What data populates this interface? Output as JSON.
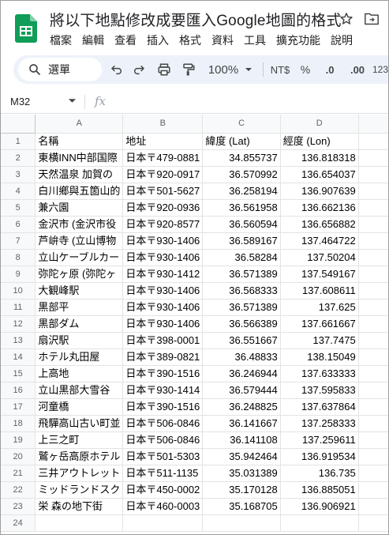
{
  "app": {
    "title": "將以下地點修改成要匯入Google地圖的格式",
    "menu": [
      "檔案",
      "編輯",
      "查看",
      "插入",
      "格式",
      "資料",
      "工具",
      "擴充功能",
      "說明"
    ]
  },
  "toolbar": {
    "menu_search_label": "選單",
    "zoom": "100%",
    "currency": "NT$",
    "percent": "%",
    "dec_decrease": ".0",
    "dec_increase": ".00",
    "more_formats": "123"
  },
  "formula_bar": {
    "cell_ref": "M32",
    "fx": "fx",
    "content": ""
  },
  "grid": {
    "columns": [
      "A",
      "B",
      "C",
      "D"
    ],
    "row_numbers": [
      "1",
      "2",
      "3",
      "4",
      "5",
      "6",
      "7",
      "8",
      "9",
      "10",
      "11",
      "12",
      "13",
      "14",
      "15",
      "16",
      "17",
      "18",
      "19",
      "20",
      "21",
      "22",
      "23",
      "24"
    ],
    "header": [
      "名稱",
      "地址",
      "緯度 (Lat)",
      "經度 (Lon)"
    ],
    "rows": [
      [
        "東横INN中部国際",
        "日本〒479-0881",
        "34.855737",
        "136.818318"
      ],
      [
        "天然温泉 加賀の",
        "日本〒920-0917",
        "36.570992",
        "136.654037"
      ],
      [
        "白川鄉與五箇山的",
        "日本〒501-5627",
        "36.258194",
        "136.907639"
      ],
      [
        "兼六園",
        "日本〒920-0936",
        "36.561958",
        "136.662136"
      ],
      [
        "金沢市 (金沢市役",
        "日本〒920-8577",
        "36.560594",
        "136.656882"
      ],
      [
        "芦峅寺 (立山博物",
        "日本〒930-1406",
        "36.589167",
        "137.464722"
      ],
      [
        "立山ケーブルカー",
        "日本〒930-1406",
        "36.58284",
        "137.50204"
      ],
      [
        "弥陀ヶ原 (弥陀ヶ",
        "日本〒930-1412",
        "36.571389",
        "137.549167"
      ],
      [
        "大観峰駅",
        "日本〒930-1406",
        "36.568333",
        "137.608611"
      ],
      [
        "黒部平",
        "日本〒930-1406",
        "36.571389",
        "137.625"
      ],
      [
        "黒部ダム",
        "日本〒930-1406",
        "36.566389",
        "137.661667"
      ],
      [
        "扇沢駅",
        "日本〒398-0001",
        "36.551667",
        "137.7475"
      ],
      [
        "ホテル丸田屋",
        "日本〒389-0821",
        "36.48833",
        "138.15049"
      ],
      [
        "上高地",
        "日本〒390-1516",
        "36.246944",
        "137.633333"
      ],
      [
        "立山黒部大雪谷",
        "日本〒930-1414",
        "36.579444",
        "137.595833"
      ],
      [
        "河童橋",
        "日本〒390-1516",
        "36.248825",
        "137.637864"
      ],
      [
        "飛驒高山古い町並",
        "日本〒506-0846",
        "36.141667",
        "137.258333"
      ],
      [
        "上三之町",
        "日本〒506-0846",
        "36.141108",
        "137.259611"
      ],
      [
        "鷲ヶ岳高原ホテル",
        "日本〒501-5303",
        "35.942464",
        "136.919534"
      ],
      [
        "三井アウトレット",
        "日本〒511-1135",
        "35.031389",
        "136.735"
      ],
      [
        "ミッドランドスク",
        "日本〒450-0002",
        "35.170128",
        "136.885051"
      ],
      [
        "栄 森の地下街",
        "日本〒460-0003",
        "35.168705",
        "136.906921"
      ],
      [
        "",
        "",
        "",
        ""
      ]
    ]
  },
  "colors": {
    "sheets_green": "#0f9d58",
    "toolbar_bg": "#edf2fa",
    "header_bg": "#f8f9fa"
  }
}
